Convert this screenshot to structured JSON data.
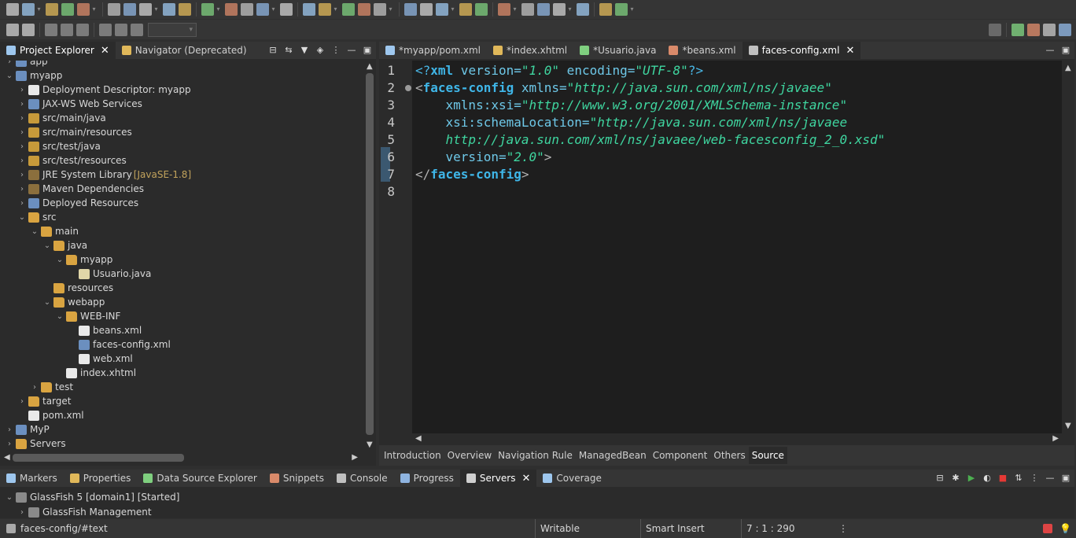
{
  "toolbar": {
    "row1_icons": [
      "new-wizard-icon",
      "save-icon",
      "save-all-icon",
      "open-type-icon",
      "search-icon",
      "debug-icon",
      "resume-icon",
      "suspend-icon",
      "terminate-icon",
      "disconnect-icon",
      "step-into-icon",
      "step-over-icon",
      "step-return-icon",
      "drop-to-frame-icon",
      "use-step-filters-icon",
      "skip-breakpoints-icon",
      "run-icon",
      "coverage-icon",
      "external-tools-icon",
      "new-project-icon",
      "open-folder-icon",
      "annotation-icon",
      "globe-icon",
      "refresh-icon",
      "task-icon",
      "next-annotation-icon",
      "prev-annotation-icon",
      "back-icon",
      "forward-icon",
      "back-history-icon",
      "forward-history-icon",
      "new-window-icon"
    ],
    "row2_icons": [
      "undo-icon",
      "redo-icon",
      "layout-icon-1",
      "layout-icon-2",
      "layout-icon-3",
      "layout-icon-4",
      "layout-icon-5",
      "layout-icon-6"
    ],
    "right_icons": [
      "quick-access-search-icon",
      "open-perspective-icon",
      "java-ee-perspective-icon",
      "debug-perspective-icon",
      "git-perspective-icon"
    ]
  },
  "explorer": {
    "tabs": [
      {
        "label": "Project Explorer",
        "active": true,
        "closable": true
      },
      {
        "label": "Navigator (Deprecated)",
        "active": false,
        "closable": false
      }
    ],
    "nodes": [
      {
        "label": "app",
        "level": 0,
        "twisty": ">",
        "icon": "proj"
      },
      {
        "label": "myapp",
        "level": 0,
        "twisty": "v",
        "icon": "proj"
      },
      {
        "label": "Deployment Descriptor: myapp",
        "level": 1,
        "twisty": ">",
        "icon": "file-xml"
      },
      {
        "label": "JAX-WS Web Services",
        "level": 1,
        "twisty": ">",
        "icon": "proj"
      },
      {
        "label": "src/main/java",
        "level": 1,
        "twisty": ">",
        "icon": "pkgfolder"
      },
      {
        "label": "src/main/resources",
        "level": 1,
        "twisty": ">",
        "icon": "pkgfolder"
      },
      {
        "label": "src/test/java",
        "level": 1,
        "twisty": ">",
        "icon": "pkgfolder"
      },
      {
        "label": "src/test/resources",
        "level": 1,
        "twisty": ">",
        "icon": "pkgfolder"
      },
      {
        "label": "JRE System Library",
        "deco": "[JavaSE-1.8]",
        "level": 1,
        "twisty": ">",
        "icon": "lib"
      },
      {
        "label": "Maven Dependencies",
        "level": 1,
        "twisty": ">",
        "icon": "lib"
      },
      {
        "label": "Deployed Resources",
        "level": 1,
        "twisty": ">",
        "icon": "proj"
      },
      {
        "label": "src",
        "level": 1,
        "twisty": "v",
        "icon": "folder"
      },
      {
        "label": "main",
        "level": 2,
        "twisty": "v",
        "icon": "folder"
      },
      {
        "label": "java",
        "level": 3,
        "twisty": "v",
        "icon": "folder"
      },
      {
        "label": "myapp",
        "level": 4,
        "twisty": "v",
        "icon": "folder"
      },
      {
        "label": "Usuario.java",
        "level": 5,
        "twisty": "",
        "icon": "file-java"
      },
      {
        "label": "resources",
        "level": 3,
        "twisty": "",
        "icon": "folder"
      },
      {
        "label": "webapp",
        "level": 3,
        "twisty": "v",
        "icon": "folder"
      },
      {
        "label": "WEB-INF",
        "level": 4,
        "twisty": "v",
        "icon": "folder"
      },
      {
        "label": "beans.xml",
        "level": 5,
        "twisty": "",
        "icon": "file-xml"
      },
      {
        "label": "faces-config.xml",
        "level": 5,
        "twisty": "",
        "icon": "proj"
      },
      {
        "label": "web.xml",
        "level": 5,
        "twisty": "",
        "icon": "file-xml"
      },
      {
        "label": "index.xhtml",
        "level": 4,
        "twisty": "",
        "icon": "file-xml"
      },
      {
        "label": "test",
        "level": 2,
        "twisty": ">",
        "icon": "folder"
      },
      {
        "label": "target",
        "level": 1,
        "twisty": ">",
        "icon": "folder"
      },
      {
        "label": "pom.xml",
        "level": 1,
        "twisty": "",
        "icon": "file-xml"
      },
      {
        "label": "MyP",
        "level": 0,
        "twisty": ">",
        "icon": "proj"
      },
      {
        "label": "Servers",
        "level": 0,
        "twisty": ">",
        "icon": "folder"
      }
    ]
  },
  "editor": {
    "tabs": [
      {
        "label": "*myapp/pom.xml",
        "icon": "m-file-icon",
        "active": false
      },
      {
        "label": "*index.xhtml",
        "icon": "file-icon",
        "active": false
      },
      {
        "label": "*Usuario.java",
        "icon": "java-file-icon",
        "active": false
      },
      {
        "label": "*beans.xml",
        "icon": "xml-file-icon",
        "active": false
      },
      {
        "label": "faces-config.xml",
        "icon": "faces-config-icon",
        "active": true
      }
    ],
    "line_numbers": [
      "1",
      "2",
      "3",
      "4",
      "5",
      "6",
      "7",
      "8"
    ],
    "lines": [
      [
        {
          "t": "<?",
          "c": "pi"
        },
        {
          "t": "xml",
          "c": "k"
        },
        {
          "t": " version=",
          "c": "a"
        },
        {
          "t": "\"1.0\"",
          "c": "s"
        },
        {
          "t": " encoding=",
          "c": "a"
        },
        {
          "t": "\"UTF-8\"",
          "c": "s"
        },
        {
          "t": "?>",
          "c": "pi"
        }
      ],
      [
        {
          "t": "<",
          "c": "p"
        },
        {
          "t": "faces-config",
          "c": "k"
        },
        {
          "t": " xmlns=",
          "c": "a"
        },
        {
          "t": "\"http://java.sun.com/xml/ns/javaee\"",
          "c": "s"
        }
      ],
      [
        {
          "t": "    xmlns:xsi=",
          "c": "a"
        },
        {
          "t": "\"http://www.w3.org/2001/XMLSchema-instance\"",
          "c": "s"
        }
      ],
      [
        {
          "t": "    xsi:schemaLocation=",
          "c": "a"
        },
        {
          "t": "\"http://java.sun.com/xml/ns/javaee",
          "c": "s"
        }
      ],
      [
        {
          "t": "    http://java.sun.com/xml/ns/javaee/web-facesconfig_2_0.xsd\"",
          "c": "s"
        }
      ],
      [
        {
          "t": "    version=",
          "c": "a"
        },
        {
          "t": "\"2.0\"",
          "c": "s"
        },
        {
          "t": ">",
          "c": "p"
        }
      ],
      [
        {
          "t": "</",
          "c": "p"
        },
        {
          "t": "faces-config",
          "c": "k"
        },
        {
          "t": ">",
          "c": "p"
        }
      ],
      []
    ],
    "page_tabs": [
      {
        "label": "Introduction",
        "active": false
      },
      {
        "label": "Overview",
        "active": false
      },
      {
        "label": "Navigation Rule",
        "active": false
      },
      {
        "label": "ManagedBean",
        "active": false
      },
      {
        "label": "Component",
        "active": false
      },
      {
        "label": "Others",
        "active": false
      },
      {
        "label": "Source",
        "active": true
      }
    ]
  },
  "bottom": {
    "tabs": [
      {
        "label": "Markers",
        "active": false,
        "closable": false
      },
      {
        "label": "Properties",
        "active": false,
        "closable": false
      },
      {
        "label": "Data Source Explorer",
        "active": false,
        "closable": false
      },
      {
        "label": "Snippets",
        "active": false,
        "closable": false
      },
      {
        "label": "Console",
        "active": false,
        "closable": false
      },
      {
        "label": "Progress",
        "active": false,
        "closable": false
      },
      {
        "label": "Servers",
        "active": true,
        "closable": true
      },
      {
        "label": "Coverage",
        "active": false,
        "closable": false
      }
    ],
    "servers": [
      {
        "label": "GlassFish 5 [domain1]  [Started]",
        "twisty": "v",
        "level": 0
      },
      {
        "label": "GlassFish Management",
        "twisty": ">",
        "level": 1
      }
    ]
  },
  "status": {
    "path": "faces-config/#text",
    "mode": "Writable",
    "insert": "Smart Insert",
    "position": "7 : 1 : 290"
  },
  "colors": {
    "background": "#2f2f2f",
    "editor_bg": "#1e1e1e",
    "tag": "#3fb6e8",
    "string": "#3fd6a0"
  }
}
